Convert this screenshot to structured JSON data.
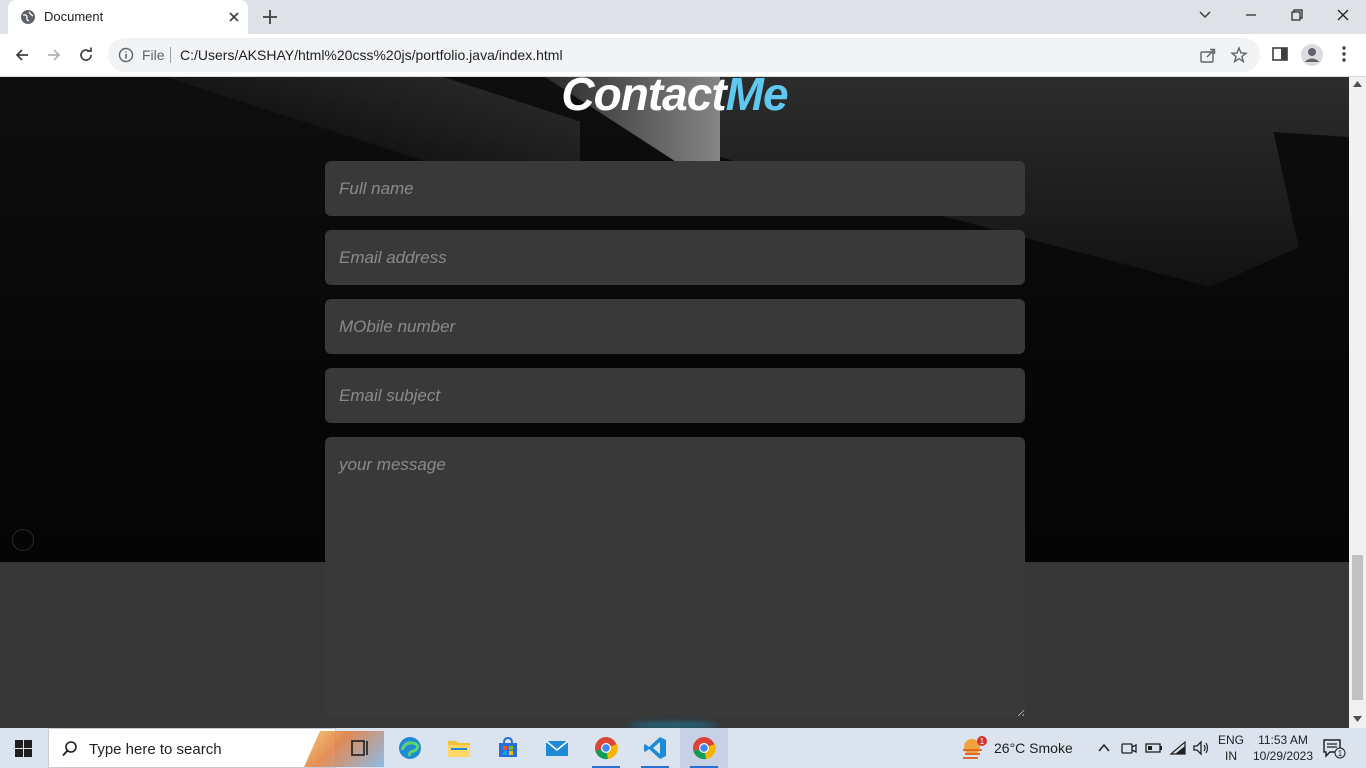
{
  "browser": {
    "tab_title": "Document",
    "address_prefix": "File",
    "url": "C:/Users/AKSHAY/html%20css%20js/portfolio.java/index.html"
  },
  "page": {
    "heading_part1": "Contact",
    "heading_part2": "Me",
    "form": {
      "fullname_placeholder": "Full name",
      "email_placeholder": "Email address",
      "mobile_placeholder": "MObile number",
      "subject_placeholder": "Email subject",
      "message_placeholder": "your message"
    },
    "colors": {
      "accent": "#5fc8f0",
      "field_bg": "#393939"
    }
  },
  "taskbar": {
    "search_placeholder": "Type here to search",
    "weather_text": "26°C  Smoke",
    "weather_badge": "1",
    "lang_line1": "ENG",
    "lang_line2": "IN",
    "time": "11:53 AM",
    "date": "10/29/2023",
    "notif_count": "1",
    "apps": [
      "task-view",
      "edge",
      "file-explorer",
      "store",
      "mail",
      "chrome",
      "vscode",
      "chrome-active"
    ]
  }
}
